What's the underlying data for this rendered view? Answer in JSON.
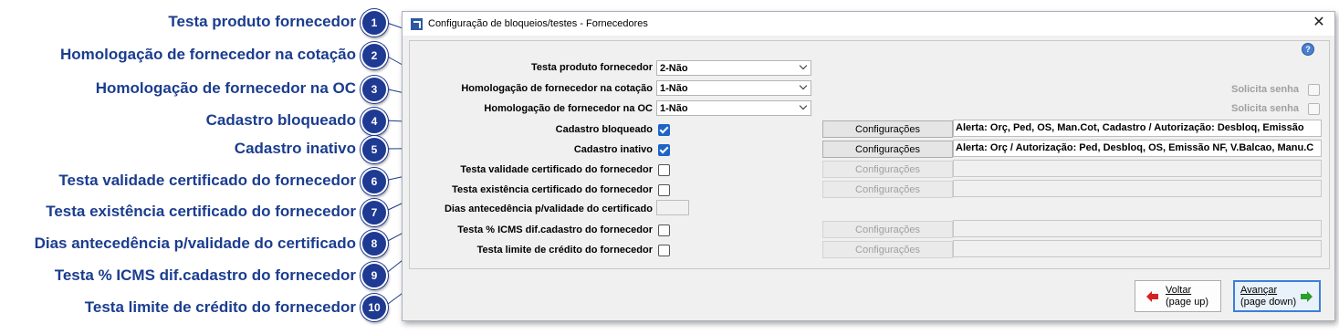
{
  "callouts": [
    {
      "num": "1",
      "label": "Testa produto fornecedor"
    },
    {
      "num": "2",
      "label": "Homologação de fornecedor na cotação"
    },
    {
      "num": "3",
      "label": "Homologação de fornecedor na OC"
    },
    {
      "num": "4",
      "label": "Cadastro bloqueado"
    },
    {
      "num": "5",
      "label": "Cadastro inativo"
    },
    {
      "num": "6",
      "label": "Testa validade certificado do fornecedor"
    },
    {
      "num": "7",
      "label": "Testa existência certificado do fornecedor"
    },
    {
      "num": "8",
      "label": "Dias antecedência p/validade do certificado"
    },
    {
      "num": "9",
      "label": "Testa % ICMS dif.cadastro do fornecedor"
    },
    {
      "num": "10",
      "label": "Testa limite de crédito do fornecedor"
    }
  ],
  "window": {
    "title": "Configuração de bloqueios/testes - Fornecedores",
    "close": "✕",
    "help": "?"
  },
  "form": {
    "testa_produto": {
      "label": "Testa produto fornecedor",
      "value": "2-Não"
    },
    "homolog_cotacao": {
      "label": "Homologação de fornecedor na cotação",
      "value": "1-Não"
    },
    "homolog_oc": {
      "label": "Homologação de fornecedor na OC",
      "value": "1-Não"
    },
    "solicita_senha": "Solicita senha",
    "cadastro_bloqueado": {
      "label": "Cadastro bloqueado",
      "checked": true,
      "config": "Configurações",
      "text": "Alerta: Orç, Ped, OS, Man.Cot, Cadastro / Autorização: Desbloq, Emissão"
    },
    "cadastro_inativo": {
      "label": "Cadastro inativo",
      "checked": true,
      "config": "Configurações",
      "text": "Alerta: Orç / Autorização: Ped, Desbloq, OS, Emissão NF, V.Balcao, Manu.C"
    },
    "validade_cert": {
      "label": "Testa validade certificado do fornecedor",
      "checked": false,
      "config": "Configurações"
    },
    "existencia_cert": {
      "label": "Testa existência certificado do fornecedor",
      "checked": false,
      "config": "Configurações"
    },
    "dias_antecedencia": {
      "label": "Dias antecedência p/validade do certificado"
    },
    "icms_dif": {
      "label": "Testa % ICMS dif.cadastro do fornecedor",
      "checked": false,
      "config": "Configurações"
    },
    "limite_credito": {
      "label": "Testa limite de crédito do fornecedor",
      "checked": false,
      "config": "Configurações"
    }
  },
  "buttons": {
    "voltar_line1": "Voltar",
    "voltar_line2": "(page up)",
    "avancar_line1": "Avançar",
    "avancar_line2": "(page down)"
  },
  "colors": {
    "callout_text": "#1b3d8f",
    "badge": "#1f3a93",
    "checkbox_checked": "#1e64c8",
    "primary_button_border": "#3c7fd8"
  }
}
